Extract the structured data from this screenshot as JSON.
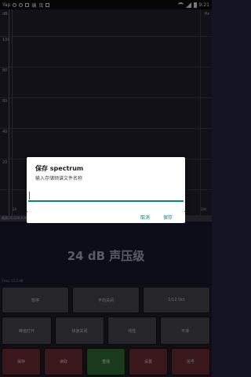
{
  "status_bar": {
    "left_text": "Yap",
    "app_glyph": "编",
    "app_glyph_2": "虫",
    "time": "9:21",
    "icons": [
      "sync-icon",
      "settings-icon",
      "sim-icon",
      "mail-icon",
      "wifi-icon",
      "signal-icon",
      "battery-icon"
    ]
  },
  "spectrum": {
    "unit": "dB",
    "hz_unit": "Hz",
    "y_labels": [
      "100",
      "80",
      "60",
      "40",
      "20"
    ],
    "x_labels": [
      "20",
      "",
      "",
      "",
      "",
      "",
      "20k"
    ],
    "info": "最高141330.0 Hz"
  },
  "readout": {
    "level_text": "24 dB 声压级",
    "hz_status": "Freq: 11.5 dB"
  },
  "controls": {
    "row1": [
      "暂停",
      "平均关闭",
      "1/12 Oct"
    ],
    "row2": [
      "峰值打开",
      "快速关闭",
      "线性",
      "平滑"
    ],
    "row3": [
      "保存",
      "读取",
      "重播",
      "设置",
      "信号"
    ]
  },
  "dialog": {
    "title": "保存 spectrum",
    "message": "输入存储频谱文件名称",
    "input_value": "",
    "cancel_label": "取消",
    "save_label": "保存"
  },
  "colors": {
    "accent": "#00897b",
    "button_gray": "#45454e",
    "button_red": "#6b2a31",
    "button_green": "#2e6b35",
    "readout_bg": "#181830"
  }
}
